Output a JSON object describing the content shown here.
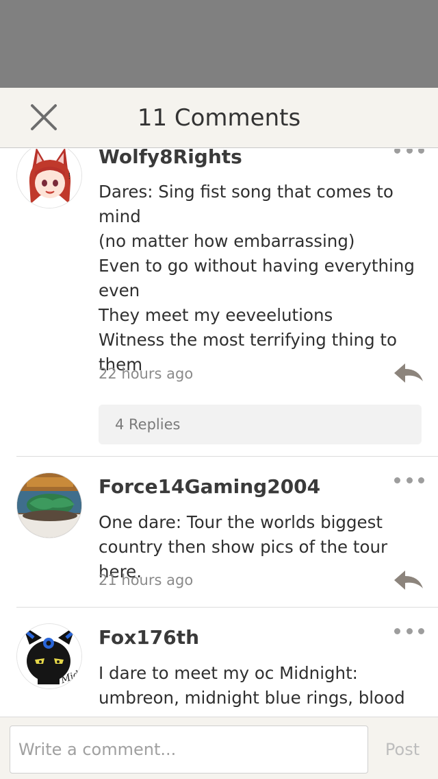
{
  "header": {
    "title": "11 Comments",
    "close_icon": "close-icon"
  },
  "comments": [
    {
      "author": "Wolfy8Rights",
      "avatar": "fox-girl-avatar",
      "body": "Dares: Sing fist song that comes to mind\n(no matter how embarrassing)\nEven to go without having everything\neven\nThey meet my eeveelutions\nWitness the most terrifying thing to\nthem",
      "time": "22 hours ago",
      "replies": "4 Replies"
    },
    {
      "author": "Force14Gaming2004",
      "avatar": "toy-photo-avatar",
      "body": "One dare: Tour the worlds biggest\ncountry then show pics of the tour here.",
      "time": "21 hours ago"
    },
    {
      "author": "Fox176th",
      "avatar": "umbreon-oc-avatar",
      "body": "I dare to meet my oc Midnight:\numbreon, midnight blue rings, blood"
    }
  ],
  "footer": {
    "placeholder": "Write a comment...",
    "post_label": "Post"
  },
  "colors": {
    "overlay": "#808080",
    "header_bg": "#f5f3ee",
    "icon_gray": "#9d9d9d"
  }
}
